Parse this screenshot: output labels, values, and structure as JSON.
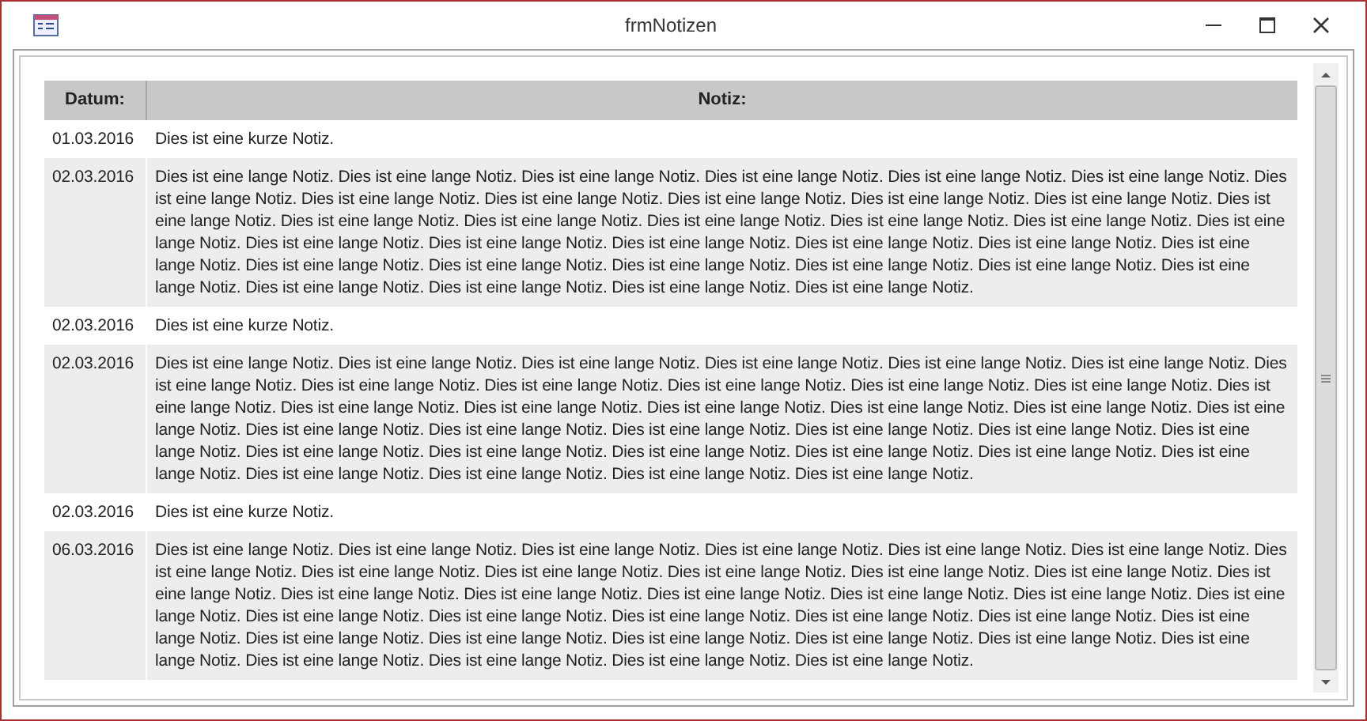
{
  "window": {
    "title": "frmNotizen"
  },
  "table": {
    "columns": [
      "Datum:",
      "Notiz:"
    ],
    "rows": [
      {
        "date": "01.03.2016",
        "note": "Dies ist eine kurze Notiz."
      },
      {
        "date": "02.03.2016",
        "note": "Dies ist eine lange Notiz. Dies ist eine lange Notiz. Dies ist eine lange Notiz. Dies ist eine lange Notiz. Dies ist eine lange Notiz. Dies ist eine lange Notiz. Dies ist eine lange Notiz. Dies ist eine lange Notiz. Dies ist eine lange Notiz. Dies ist eine lange Notiz. Dies ist eine lange Notiz. Dies ist eine lange Notiz. Dies ist eine lange Notiz. Dies ist eine lange Notiz. Dies ist eine lange Notiz. Dies ist eine lange Notiz. Dies ist eine lange Notiz. Dies ist eine lange Notiz. Dies ist eine lange Notiz. Dies ist eine lange Notiz. Dies ist eine lange Notiz. Dies ist eine lange Notiz. Dies ist eine lange Notiz. Dies ist eine lange Notiz. Dies ist eine lange Notiz. Dies ist eine lange Notiz. Dies ist eine lange Notiz. Dies ist eine lange Notiz. Dies ist eine lange Notiz. Dies ist eine lange Notiz. Dies ist eine lange Notiz. Dies ist eine lange Notiz. Dies ist eine lange Notiz. Dies ist eine lange Notiz. Dies ist eine lange Notiz."
      },
      {
        "date": "02.03.2016",
        "note": "Dies ist eine kurze Notiz."
      },
      {
        "date": "02.03.2016",
        "note": "Dies ist eine lange Notiz. Dies ist eine lange Notiz. Dies ist eine lange Notiz. Dies ist eine lange Notiz. Dies ist eine lange Notiz. Dies ist eine lange Notiz. Dies ist eine lange Notiz. Dies ist eine lange Notiz. Dies ist eine lange Notiz. Dies ist eine lange Notiz. Dies ist eine lange Notiz. Dies ist eine lange Notiz. Dies ist eine lange Notiz. Dies ist eine lange Notiz. Dies ist eine lange Notiz. Dies ist eine lange Notiz. Dies ist eine lange Notiz. Dies ist eine lange Notiz. Dies ist eine lange Notiz. Dies ist eine lange Notiz. Dies ist eine lange Notiz. Dies ist eine lange Notiz. Dies ist eine lange Notiz. Dies ist eine lange Notiz. Dies ist eine lange Notiz. Dies ist eine lange Notiz. Dies ist eine lange Notiz. Dies ist eine lange Notiz. Dies ist eine lange Notiz. Dies ist eine lange Notiz. Dies ist eine lange Notiz. Dies ist eine lange Notiz. Dies ist eine lange Notiz. Dies ist eine lange Notiz. Dies ist eine lange Notiz."
      },
      {
        "date": "02.03.2016",
        "note": "Dies ist eine kurze Notiz."
      },
      {
        "date": "06.03.2016",
        "note": "Dies ist eine lange Notiz. Dies ist eine lange Notiz. Dies ist eine lange Notiz. Dies ist eine lange Notiz. Dies ist eine lange Notiz. Dies ist eine lange Notiz. Dies ist eine lange Notiz. Dies ist eine lange Notiz. Dies ist eine lange Notiz. Dies ist eine lange Notiz. Dies ist eine lange Notiz. Dies ist eine lange Notiz. Dies ist eine lange Notiz. Dies ist eine lange Notiz. Dies ist eine lange Notiz. Dies ist eine lange Notiz. Dies ist eine lange Notiz. Dies ist eine lange Notiz. Dies ist eine lange Notiz. Dies ist eine lange Notiz. Dies ist eine lange Notiz. Dies ist eine lange Notiz. Dies ist eine lange Notiz. Dies ist eine lange Notiz. Dies ist eine lange Notiz. Dies ist eine lange Notiz. Dies ist eine lange Notiz. Dies ist eine lange Notiz. Dies ist eine lange Notiz. Dies ist eine lange Notiz. Dies ist eine lange Notiz. Dies ist eine lange Notiz. Dies ist eine lange Notiz. Dies ist eine lange Notiz. Dies ist eine lange Notiz."
      }
    ]
  }
}
